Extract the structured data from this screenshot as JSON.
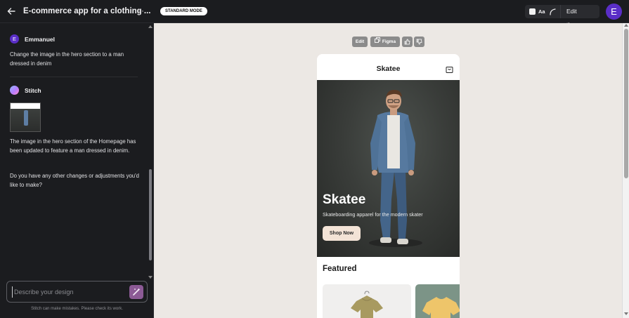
{
  "header": {
    "project_title": "E-commerce app for a clothing ...",
    "mode_label": "STANDARD MODE",
    "aa_label": "Aa",
    "edit_theme_label": "Edit theme",
    "avatar_initial": "E"
  },
  "chat": {
    "user": {
      "initial": "E",
      "name": "Emmanuel",
      "message": "Change the image in the hero section to a man dressed in denim"
    },
    "assistant": {
      "name": "Stitch",
      "reply_1": "The image in the hero section of the Homepage has been updated to feature a man dressed in denim.",
      "reply_2": "Do you have any other changes or adjustments you'd like to make?"
    },
    "composer_placeholder": "Describe your design",
    "disclaimer": "Stitch can make mistakes. Please check its work."
  },
  "canvas": {
    "toolbar": {
      "edit_label": "Edit",
      "figma_label": "Figma"
    },
    "phone": {
      "app_name": "Skatee",
      "hero_title": "Skatee",
      "hero_subtitle": "Skateboarding apparel for the modern skater",
      "cta_label": "Shop Now",
      "section_title": "Featured"
    }
  },
  "colors": {
    "accent_purple": "#5a2ec7",
    "magic_button": "#8c5a95",
    "canvas_bg": "#ece8e4",
    "cta_bg": "#f3e3d6"
  },
  "icons": [
    "back-arrow-icon",
    "more-icon",
    "color-square-icon",
    "arc-icon",
    "stitch-logo-icon",
    "magic-wand-icon",
    "copy-icon",
    "thumbs-up-icon",
    "thumbs-down-icon",
    "shopping-bag-icon"
  ]
}
